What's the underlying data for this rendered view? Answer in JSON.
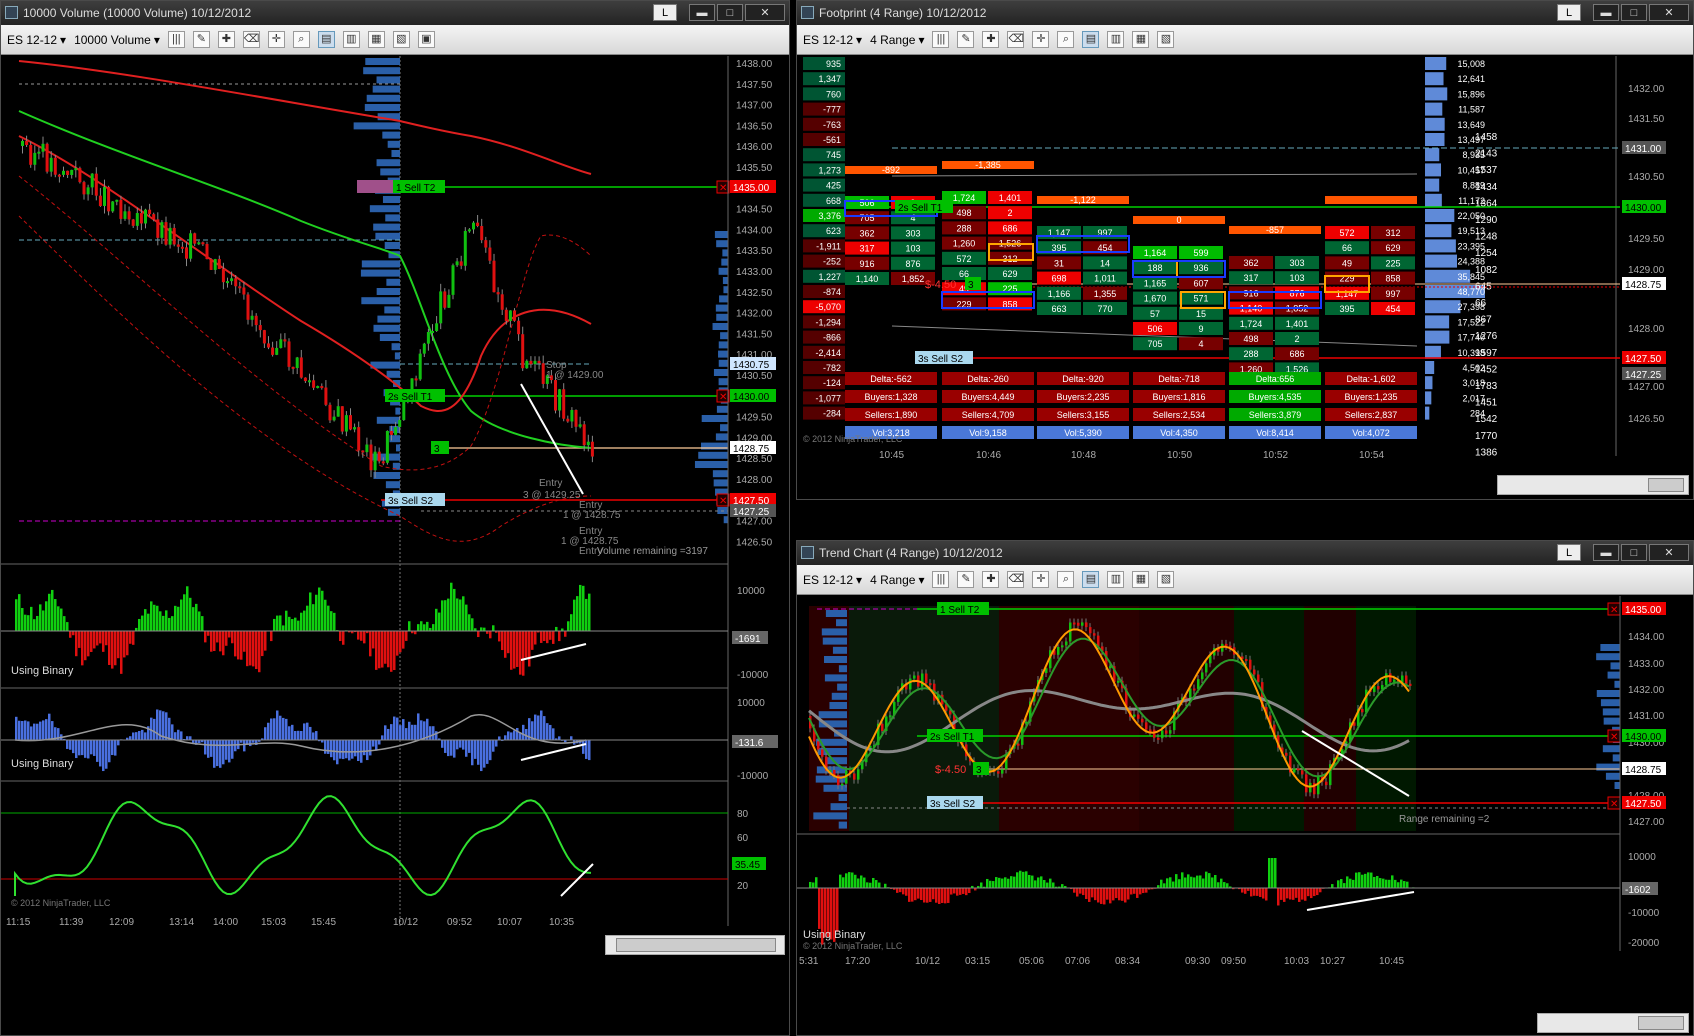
{
  "windows": {
    "volume": {
      "title": "10000 Volume (10000 Volume)  10/12/2012",
      "instrument": "ES 12-12",
      "period": "10000 Volume",
      "price_ticks": [
        "1438.00",
        "1437.50",
        "1437.00",
        "1436.50",
        "1436.00",
        "1435.50",
        "1435.00",
        "1434.50",
        "1434.00",
        "1433.50",
        "1433.00",
        "1432.50",
        "1432.00",
        "1431.50",
        "1431.00",
        "1430.50",
        "1430.00",
        "1429.50",
        "1429.00",
        "1428.50",
        "1428.00",
        "1427.50",
        "1427.00",
        "1426.50"
      ],
      "price_flags": {
        "sell_t2": "1435.00",
        "upper_blue": "1430.75",
        "sell_t1": "1430.00",
        "current": "1428.75",
        "sell_s2": "1427.50",
        "lower": "1427.25"
      },
      "orders": {
        "t2": "1",
        "t2_label": "Sell T2",
        "t1": "2s",
        "t1_label": "Sell T1",
        "entry_qty": "3",
        "s2": "3s",
        "s2_label": "Sell S2"
      },
      "annotations": [
        "Stop",
        "1 @ 1429.00",
        "Entry",
        "3 @ 1429.25",
        "Entry",
        "1 @ 1428.75",
        "Entry",
        "1 @ 1428.75",
        "Entry"
      ],
      "volume_remaining": "Volume remaining =3197",
      "panel1": {
        "label": "Using Binary",
        "ticks": [
          "10000",
          "-10000"
        ],
        "value": "-1691"
      },
      "panel2": {
        "label": "Using Binary",
        "ticks": [
          "10000",
          "-10000"
        ],
        "value": "-131.6"
      },
      "panel3": {
        "ticks": [
          "80",
          "60",
          "40",
          "20"
        ],
        "value": "35.45"
      },
      "time_labels": [
        "11:15",
        "11:39",
        "12:09",
        "13:14",
        "14:00",
        "15:03",
        "15:45",
        "10/12",
        "09:52",
        "10:07",
        "10:35"
      ],
      "copyright": "© 2012 NinjaTrader, LLC"
    },
    "footprint": {
      "title": "Footprint (4 Range)  10/12/2012",
      "instrument": "ES 12-12",
      "period": "4 Range",
      "left_deltas": [
        "935",
        "1,347",
        "760",
        "-777",
        "-763",
        "-561",
        "745",
        "1,273",
        "425",
        "668",
        "3,376",
        "623",
        "-1,911",
        "-252",
        "1,227",
        "-874",
        "-5,070",
        "-1,294",
        "-866",
        "-2,414",
        "-782",
        "-124",
        "-1,077",
        "-284"
      ],
      "right_volumes": [
        "15,008",
        "12,641",
        "15,896",
        "11,587",
        "13,649",
        "13,497",
        "8,935",
        "10,457",
        "8,889",
        "11,172",
        "22,050",
        "19,513",
        "23,395",
        "24,388",
        "35,845",
        "48,770",
        "27,398",
        "17,522",
        "17,740",
        "10,398",
        "4,502",
        "3,018",
        "2,017",
        "284"
      ],
      "right_counts": [
        "1458",
        "2143",
        "1537",
        "1434",
        "1364",
        "1290",
        "1248",
        "1254",
        "1082",
        "645",
        "66",
        "867",
        "1276",
        "1597",
        "1452",
        "1783",
        "1451",
        "1542",
        "1770",
        "1386"
      ],
      "price_ticks": [
        "1432.00",
        "1431.50",
        "1431.00",
        "1430.50",
        "1430.00",
        "1429.50",
        "1429.00",
        "1428.75",
        "1428.00",
        "1427.50",
        "1427.25",
        "1427.00",
        "1426.50"
      ],
      "price_flags": {
        "upper": "1431.00",
        "sell_t1": "1430.00",
        "current": "1428.75",
        "sell_s2": "1427.50",
        "lower": "1427.25"
      },
      "pnl": "$-4.50",
      "bar_stats": [
        {
          "delta": "Delta:-562",
          "buyers": "Buyers:1,328",
          "sellers": "Sellers:1,890",
          "vol": "Vol:3,218",
          "time": "10:45"
        },
        {
          "delta": "Delta:-260",
          "buyers": "Buyers:4,449",
          "sellers": "Sellers:4,709",
          "vol": "Vol:9,158",
          "time": "10:46"
        },
        {
          "delta": "Delta:-920",
          "buyers": "Buyers:2,235",
          "sellers": "Sellers:3,155",
          "vol": "Vol:5,390",
          "time": "10:48"
        },
        {
          "delta": "Delta:-718",
          "buyers": "Buyers:1,816",
          "sellers": "Sellers:2,534",
          "vol": "Vol:4,350",
          "time": "10:50"
        },
        {
          "delta": "Delta:656",
          "buyers": "Buyers:4,535",
          "sellers": "Sellers:3,879",
          "vol": "Vol:8,414",
          "time": "10:52"
        },
        {
          "delta": "Delta:-1,602",
          "buyers": "Buyers:1,235",
          "sellers": "Sellers:2,837",
          "vol": "Vol:4,072",
          "time": "10:54"
        }
      ],
      "bar_deltas": [
        "-892",
        "-1,385",
        "-1,122",
        "0",
        "-857"
      ],
      "cells": [
        "506",
        "9",
        "705",
        "4",
        "362",
        "303",
        "317",
        "103",
        "916",
        "876",
        "1,140",
        "1,852",
        "1,724",
        "1,401",
        "498",
        "2",
        "288",
        "686",
        "1,260",
        "1,526",
        "572",
        "312",
        "66",
        "629",
        "49",
        "225",
        "229",
        "858",
        "1,147",
        "997",
        "395",
        "454",
        "31",
        "14",
        "698",
        "1,011",
        "1,166",
        "1,355",
        "663",
        "770",
        "1,164",
        "599",
        "188",
        "936",
        "1,165",
        "607",
        "1,670",
        "571",
        "57",
        "15"
      ],
      "copyright": "© 2012 NinjaTrader, LLC"
    },
    "trend": {
      "title": "Trend Chart (4 Range)  10/12/2012",
      "instrument": "ES 12-12",
      "period": "4 Range",
      "price_ticks": [
        "1435.00",
        "1434.00",
        "1433.00",
        "1432.00",
        "1431.00",
        "1430.00",
        "1429.00",
        "1428.00",
        "1427.00"
      ],
      "price_flags": {
        "sell_t2": "1435.00",
        "sell_t1": "1430.00",
        "current": "1428.75",
        "sell_s2": "1427.50"
      },
      "pnl": "$-4.50",
      "range_remaining": "Range remaining =2",
      "panel": {
        "label": "Using Binary",
        "ticks": [
          "10000",
          "0",
          "-10000",
          "-20000"
        ],
        "value": "-1602"
      },
      "time_labels": [
        "5:31",
        "17:20",
        "10/12",
        "03:15",
        "05:06",
        "07:06",
        "08:34",
        "09:30",
        "09:50",
        "10:03",
        "10:27",
        "10:45"
      ],
      "copyright": "© 2012 NinjaTrader, LLC"
    }
  },
  "colors": {
    "green": "#00e000",
    "red": "#e01010",
    "blue": "#4a78d8",
    "orange": "#ff9900",
    "profile": "#2a5fa8"
  }
}
